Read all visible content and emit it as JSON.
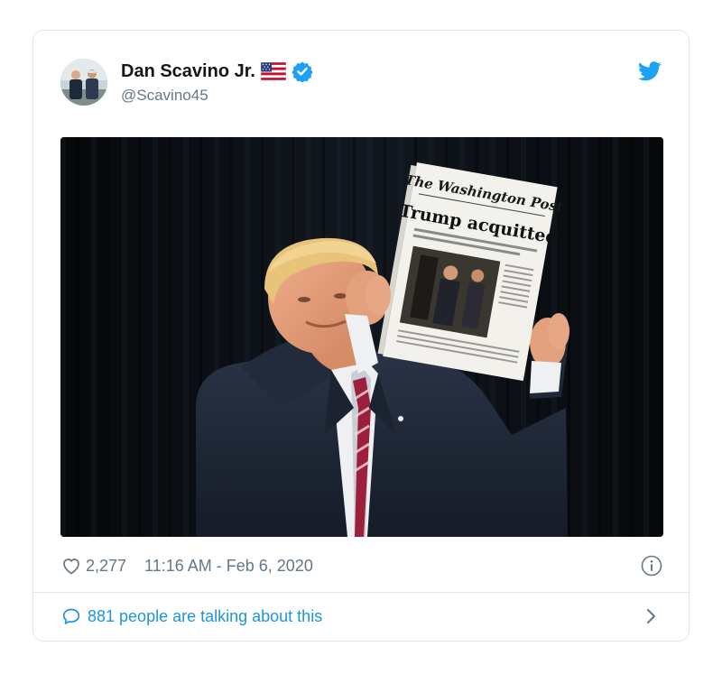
{
  "tweet": {
    "author": {
      "display_name": "Dan Scavino Jr.",
      "handle": "@Scavino45",
      "flag_icon": "us-flag-icon",
      "verified_icon": "verified-badge-icon"
    },
    "brand_icon": "twitter-bird-icon",
    "media": {
      "newspaper_masthead": "The Washington Post",
      "newspaper_headline": "Trump acquitted"
    },
    "likes": "2,277",
    "timestamp": "11:16 AM - Feb 6, 2020",
    "conversation_text": "881 people are talking about this"
  },
  "colors": {
    "twitter_blue": "#1da1f2",
    "link_blue": "#1b95e0",
    "muted_gray": "#657786",
    "border": "#e1e8ed"
  }
}
